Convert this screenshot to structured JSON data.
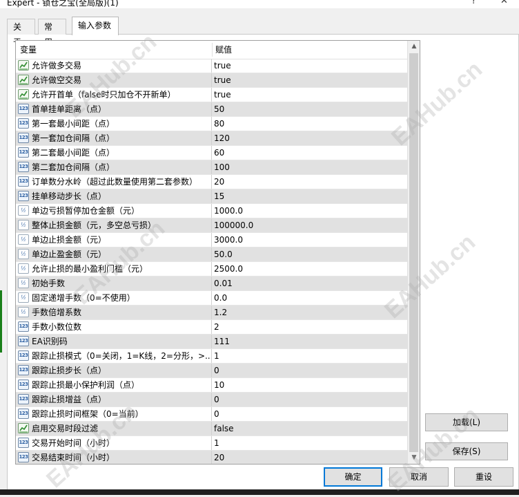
{
  "window": {
    "title": "Expert - 锁仓之宝(全局版)(1)"
  },
  "tabs": [
    {
      "label": "关于",
      "active": false
    },
    {
      "label": "常用",
      "active": false
    },
    {
      "label": "输入参数",
      "active": true
    }
  ],
  "grid": {
    "header": {
      "name": "变量",
      "value": "赋值"
    },
    "rows": [
      {
        "icon": "bool-icon",
        "name": "允许做多交易",
        "value": "true"
      },
      {
        "icon": "bool-icon",
        "name": "允许做空交易",
        "value": "true"
      },
      {
        "icon": "bool-icon",
        "name": "允许开首单（false时只加仓不开新单）",
        "value": "true"
      },
      {
        "icon": "int-icon",
        "name": "首单挂单距离（点）",
        "value": "50"
      },
      {
        "icon": "int-icon",
        "name": "第一套最小间距（点）",
        "value": "80"
      },
      {
        "icon": "int-icon",
        "name": "第一套加仓间隔（点）",
        "value": "120"
      },
      {
        "icon": "int-icon",
        "name": "第二套最小间距（点）",
        "value": "60"
      },
      {
        "icon": "int-icon",
        "name": "第二套加仓间隔（点）",
        "value": "100"
      },
      {
        "icon": "int-icon",
        "name": "订单数分水岭（超过此数量使用第二套参数）",
        "value": "20"
      },
      {
        "icon": "int-icon",
        "name": "挂单移动步长（点）",
        "value": "15"
      },
      {
        "icon": "double-icon",
        "name": "单边亏损暂停加仓金额（元）",
        "value": "1000.0"
      },
      {
        "icon": "double-icon",
        "name": "整体止损金额（元，多空总亏损）",
        "value": "100000.0"
      },
      {
        "icon": "double-icon",
        "name": "单边止损金额（元）",
        "value": "3000.0"
      },
      {
        "icon": "double-icon",
        "name": "单边止盈金额（元）",
        "value": "50.0"
      },
      {
        "icon": "double-icon",
        "name": "允许止损的最小盈利门槛（元）",
        "value": "2500.0"
      },
      {
        "icon": "double-icon",
        "name": "初始手数",
        "value": "0.01"
      },
      {
        "icon": "double-icon",
        "name": "固定递增手数（0=不使用）",
        "value": "0.0"
      },
      {
        "icon": "double-icon",
        "name": "手数倍增系数",
        "value": "1.2"
      },
      {
        "icon": "int-icon",
        "name": "手数小数位数",
        "value": "2"
      },
      {
        "icon": "int-icon",
        "name": "EA识别码",
        "value": "111"
      },
      {
        "icon": "int-icon",
        "name": "跟踪止损模式（0=关闭，1=K线，2=分形，>...",
        "value": "1"
      },
      {
        "icon": "int-icon",
        "name": "跟踪止损步长（点）",
        "value": "0"
      },
      {
        "icon": "int-icon",
        "name": "跟踪止损最小保护利润（点）",
        "value": "10"
      },
      {
        "icon": "int-icon",
        "name": "跟踪止损增益（点）",
        "value": "0"
      },
      {
        "icon": "int-icon",
        "name": "跟踪止损时间框架（0=当前）",
        "value": "0"
      },
      {
        "icon": "bool-icon",
        "name": "启用交易时段过滤",
        "value": "false"
      },
      {
        "icon": "int-icon",
        "name": "交易开始时间（小时）",
        "value": "1"
      },
      {
        "icon": "int-icon",
        "name": "交易结束时间（小时）",
        "value": "20"
      }
    ]
  },
  "icons": {
    "int_text": "123",
    "double_text": "½"
  },
  "side_buttons": {
    "load_label": "加载(L)",
    "save_label": "保存(S)"
  },
  "bottom_buttons": {
    "ok_label": "确定",
    "cancel_label": "取消",
    "reset_label": "重设"
  },
  "watermark": "EAHub.cn",
  "colors": {
    "accent": "#0078d7",
    "alt_row": "#e1e1e1"
  }
}
